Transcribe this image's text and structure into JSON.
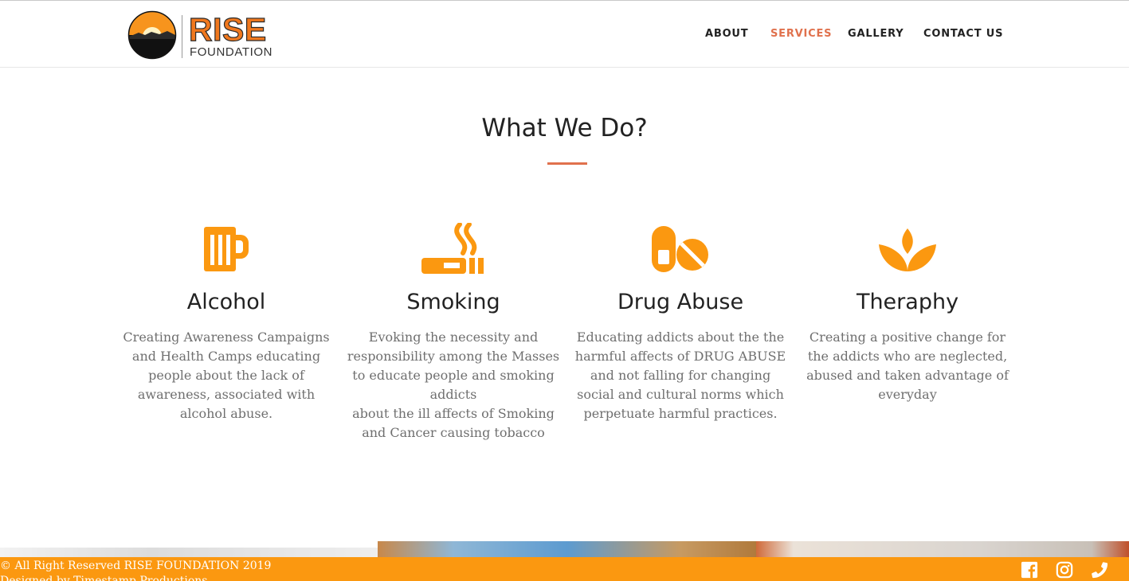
{
  "brand": {
    "name": "RISE",
    "tagline": "FOUNDATION"
  },
  "nav": {
    "items": [
      {
        "label": "ABOUT",
        "active": false
      },
      {
        "label": "SERVICES",
        "active": true
      },
      {
        "label": "GALLERY",
        "active": false
      },
      {
        "label": "CONTACT US",
        "active": false
      }
    ]
  },
  "section": {
    "title": "What We Do?"
  },
  "services": [
    {
      "icon": "beer-mug-icon",
      "title": "Alcohol",
      "description": "Creating Awareness Campaigns and Health Camps educating people about the lack of awareness, associated with alcohol abuse."
    },
    {
      "icon": "cigarette-icon",
      "title": "Smoking",
      "description_lines": [
        "Evoking the necessity and responsibility among the Masses to educate people and smoking addicts",
        "about the ill affects of Smoking and Cancer causing tobacco"
      ]
    },
    {
      "icon": "pills-icon",
      "title": "Drug Abuse",
      "description": "Educating addicts about the the harmful affects of DRUG ABUSE and not falling for changing social and cultural norms which perpetuate harmful practices."
    },
    {
      "icon": "lotus-icon",
      "title": "Theraphy",
      "description": "Creating a positive change for the addicts who are neglected, abused and taken advantage of everyday"
    }
  ],
  "footer": {
    "copyright": "© All Right Reserved RISE FOUNDATION 2019",
    "credit": "Designed by Timestamp Productions",
    "social": [
      "facebook-icon",
      "instagram-icon",
      "phone-icon"
    ]
  },
  "colors": {
    "accent": "#fb9810",
    "highlight": "#e0714d",
    "text": "#222222",
    "muted": "#6f6f6f"
  }
}
